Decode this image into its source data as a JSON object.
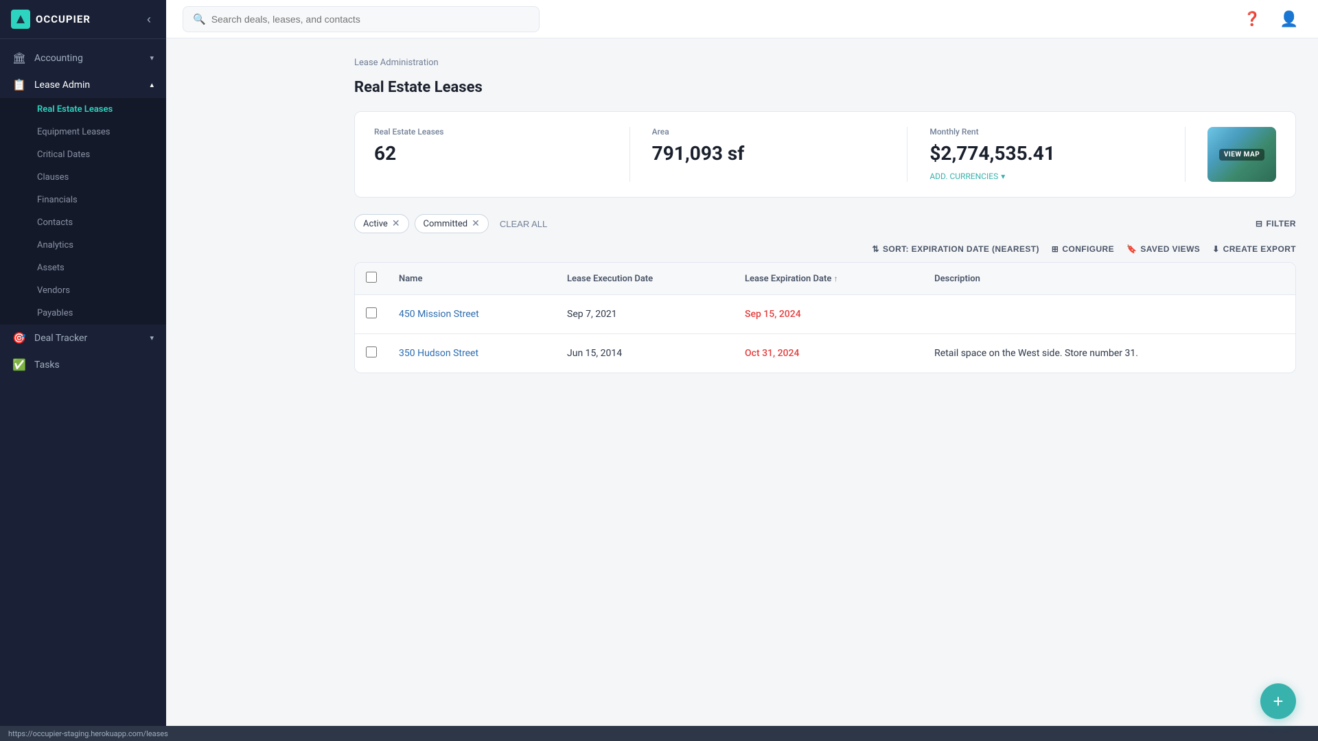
{
  "app": {
    "name": "OCCUPIER",
    "logo_icon": "🟩"
  },
  "topbar": {
    "search_placeholder": "Search deals, leases, and contacts",
    "help_icon": "❓",
    "user_icon": "👤"
  },
  "sidebar": {
    "collapse_icon": "‹",
    "items": [
      {
        "id": "accounting",
        "label": "Accounting",
        "icon": "🏛",
        "has_arrow": true,
        "active": false
      },
      {
        "id": "lease-admin",
        "label": "Lease Admin",
        "icon": "📋",
        "has_arrow": true,
        "active": true,
        "subitems": [
          {
            "id": "real-estate-leases",
            "label": "Real Estate Leases",
            "active": true
          },
          {
            "id": "equipment-leases",
            "label": "Equipment Leases",
            "active": false
          },
          {
            "id": "critical-dates",
            "label": "Critical Dates",
            "active": false
          },
          {
            "id": "clauses",
            "label": "Clauses",
            "active": false
          },
          {
            "id": "financials",
            "label": "Financials",
            "active": false
          },
          {
            "id": "contacts",
            "label": "Contacts",
            "active": false
          },
          {
            "id": "analytics",
            "label": "Analytics",
            "active": false
          },
          {
            "id": "assets",
            "label": "Assets",
            "active": false
          },
          {
            "id": "vendors",
            "label": "Vendors",
            "active": false
          },
          {
            "id": "payables",
            "label": "Payables",
            "active": false
          }
        ]
      },
      {
        "id": "deal-tracker",
        "label": "Deal Tracker",
        "icon": "🎯",
        "has_arrow": true,
        "active": false
      },
      {
        "id": "tasks",
        "label": "Tasks",
        "icon": "✅",
        "has_arrow": false,
        "active": false
      }
    ]
  },
  "breadcrumb": "Lease Administration",
  "page_title": "Real Estate Leases",
  "stats": {
    "leases_label": "Real Estate Leases",
    "leases_value": "62",
    "area_label": "Area",
    "area_value": "791,093 sf",
    "monthly_rent_label": "Monthly Rent",
    "monthly_rent_value": "$2,774,535.41",
    "add_currencies_label": "ADD. CURRENCIES",
    "view_map_label": "VIEW MAP"
  },
  "filters": [
    {
      "id": "active",
      "label": "Active"
    },
    {
      "id": "committed",
      "label": "Committed"
    }
  ],
  "clear_all_label": "CLEAR ALL",
  "toolbar": {
    "sort_label": "SORT: EXPIRATION DATE (NEAREST)",
    "configure_label": "CONFIGURE",
    "saved_views_label": "SAVED VIEWS",
    "create_export_label": "CREATE EXPORT",
    "filter_label": "FILTER"
  },
  "table": {
    "columns": [
      {
        "id": "name",
        "label": "Name",
        "sortable": false
      },
      {
        "id": "execution_date",
        "label": "Lease Execution Date",
        "sortable": false
      },
      {
        "id": "expiration_date",
        "label": "Lease Expiration Date",
        "sortable": true
      },
      {
        "id": "description",
        "label": "Description",
        "sortable": false
      }
    ],
    "rows": [
      {
        "id": "row-1",
        "name": "450 Mission Street",
        "execution_date": "Sep 7, 2021",
        "expiration_date": "Sep 15, 2024",
        "expiration_expired": true,
        "description": ""
      },
      {
        "id": "row-2",
        "name": "350 Hudson Street",
        "execution_date": "Jun 15, 2014",
        "expiration_date": "Oct 31, 2024",
        "expiration_expired": true,
        "description": "Retail space on the West side. Store number 31."
      }
    ]
  },
  "fab_icon": "+",
  "statusbar": {
    "url": "https://occupier-staging.herokuapp.com/leases"
  }
}
